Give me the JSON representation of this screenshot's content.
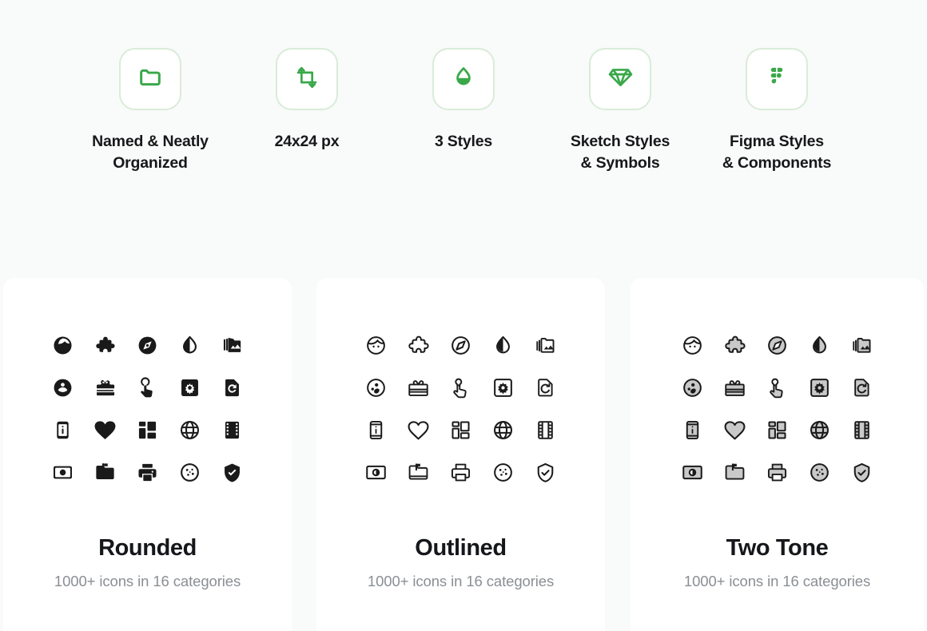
{
  "theme": {
    "page_background": "#f9fafa",
    "card_background": "#ffffff",
    "accent_green": "#3aa84a",
    "accent_green_soft": "#d9ecd9",
    "icon_dark": "#1a1a1a",
    "icon_tone": "#c9c9c9",
    "title_color": "#15171a",
    "subtitle_color": "#8b8f94"
  },
  "features": [
    {
      "icon": "folder-icon",
      "label": "Named & Neatly\nOrganized"
    },
    {
      "icon": "crop-resize-icon",
      "label": "24x24 px"
    },
    {
      "icon": "water-drop-icon",
      "label": "3 Styles"
    },
    {
      "icon": "diamond-sketch-icon",
      "label": "Sketch Styles\n& Symbols"
    },
    {
      "icon": "figma-logo-icon",
      "label": "Figma Styles\n& Components"
    }
  ],
  "style_cards": [
    {
      "title": "Rounded",
      "subtitle": "1000+ icons in 16 categories",
      "variant": "rounded"
    },
    {
      "title": "Outlined",
      "subtitle": "1000+ icons in 16 categories",
      "variant": "outlined"
    },
    {
      "title": "Two Tone",
      "subtitle": "1000+ icons in 16 categories",
      "variant": "twotone"
    }
  ],
  "icon_grid": {
    "rows": 4,
    "cols": 5,
    "names": [
      "face-child-icon",
      "puzzle-piece-icon",
      "compass-explore-icon",
      "water-drop-contrast-icon",
      "photo-library-icon",
      "group-people-icon",
      "card-giftcard-icon",
      "touch-app-icon",
      "settings-gear-square-icon",
      "restore-page-icon",
      "phone-info-icon",
      "heart-favorite-icon",
      "dashboard-layout-icon",
      "globe-language-icon",
      "film-strip-icon",
      "brightness-contrast-icon",
      "drive-folder-upload-icon",
      "printer-icon",
      "cookie-icon",
      "verified-shield-icon"
    ]
  }
}
